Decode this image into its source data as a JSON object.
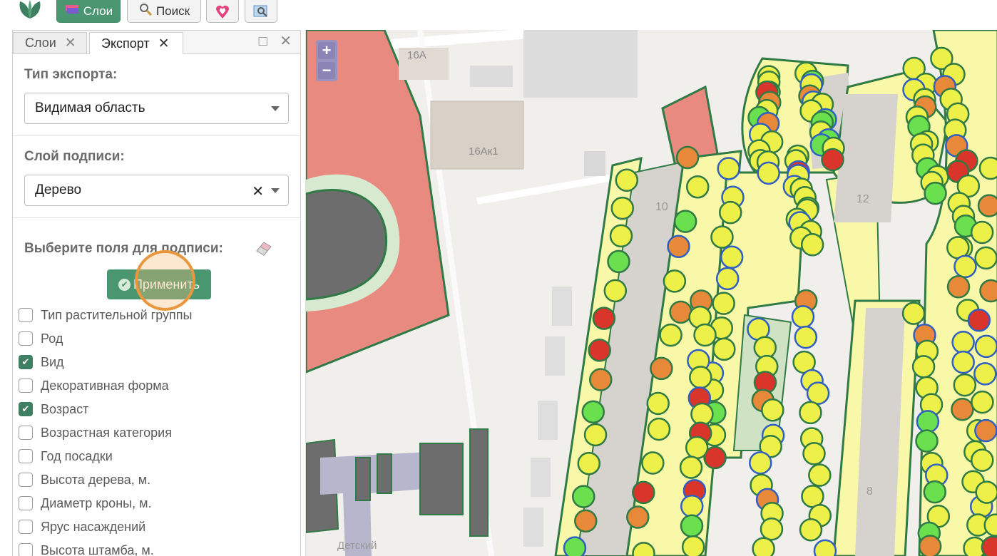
{
  "toolbar": {
    "layers_label": "Слои",
    "search_label": "Поиск"
  },
  "panel": {
    "tabs": [
      {
        "label": "Слои"
      },
      {
        "label": "Экспорт"
      }
    ],
    "export_type_label": "Тип экспорта:",
    "export_type_value": "Видимая область",
    "label_layer_label": "Слой подписи:",
    "label_layer_value": "Дерево",
    "choose_fields_label": "Выберите поля для подписи:",
    "apply_label": "Применить",
    "fields": [
      {
        "label": "Тип растительной группы",
        "checked": false
      },
      {
        "label": "Род",
        "checked": false
      },
      {
        "label": "Вид",
        "checked": true
      },
      {
        "label": "Декоративная форма",
        "checked": false
      },
      {
        "label": "Возраст",
        "checked": true
      },
      {
        "label": "Возрастная категория",
        "checked": false
      },
      {
        "label": "Год посадки",
        "checked": false
      },
      {
        "label": "Высота дерева, м.",
        "checked": false
      },
      {
        "label": "Диаметр кроны, м.",
        "checked": false
      },
      {
        "label": "Ярус насаждений",
        "checked": false
      },
      {
        "label": "Высота штамба, м.",
        "checked": false
      }
    ]
  },
  "map": {
    "zoom_in": "+",
    "zoom_out": "−",
    "building_labels": [
      "16А",
      "16Ак1",
      "10",
      "12",
      "8",
      "Детский"
    ],
    "colors": {
      "tree_yellow": "#eef04a",
      "tree_green": "#6be04f",
      "tree_orange": "#e8893a",
      "tree_red": "#d9352a",
      "outline": "#2f7a45",
      "blue_ring": "#2f5fc0",
      "zone_red": "#e88a80",
      "lawn": "#f8f8a8"
    }
  }
}
